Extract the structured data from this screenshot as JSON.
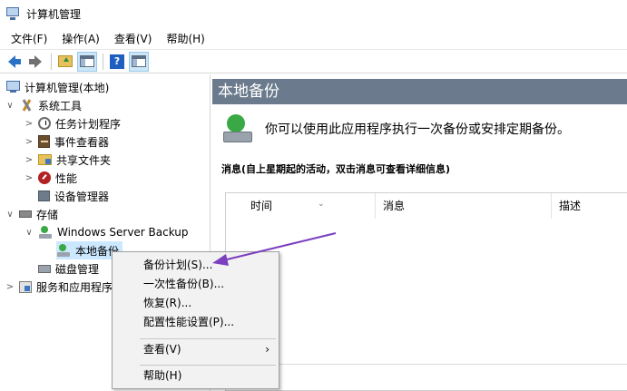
{
  "window": {
    "title": "计算机管理"
  },
  "menubar": {
    "items": [
      "文件(F)",
      "操作(A)",
      "查看(V)",
      "帮助(H)"
    ]
  },
  "toolbar": {
    "buttons": [
      "back-icon",
      "forward-icon",
      "up-folder-icon",
      "show-hide-tree-icon",
      "help-icon",
      "show-action-pane-icon"
    ],
    "help_glyph": "?"
  },
  "tree": {
    "items": [
      {
        "label": "计算机管理(本地)",
        "icon": "computer-icon",
        "expander": ""
      },
      {
        "label": "系统工具",
        "icon": "tools-icon",
        "expander": "∨"
      },
      {
        "label": "任务计划程序",
        "icon": "clock-icon",
        "expander": ">"
      },
      {
        "label": "事件查看器",
        "icon": "event-viewer-icon",
        "expander": ">"
      },
      {
        "label": "共享文件夹",
        "icon": "shared-folder-icon",
        "expander": ">"
      },
      {
        "label": "性能",
        "icon": "performance-icon",
        "expander": ">"
      },
      {
        "label": "设备管理器",
        "icon": "device-manager-icon",
        "expander": ""
      },
      {
        "label": "存储",
        "icon": "storage-icon",
        "expander": "∨"
      },
      {
        "label": "Windows Server Backup",
        "icon": "backup-icon",
        "expander": "∨"
      },
      {
        "label": "本地备份",
        "icon": "backup-icon",
        "expander": ""
      },
      {
        "label": "磁盘管理",
        "icon": "disk-icon",
        "expander": ""
      },
      {
        "label": "服务和应用程序",
        "icon": "services-icon",
        "expander": ">"
      }
    ]
  },
  "main": {
    "header": "本地备份",
    "intro": "你可以使用此应用程序执行一次备份或安排定期备份。",
    "messages_title": "消息(自上星期起的活动，双击消息可查看详细信息)",
    "columns": [
      "时间",
      "消息",
      "描述"
    ],
    "sort_caret": "⌄"
  },
  "context_menu": {
    "items": [
      "备份计划(S)...",
      "一次性备份(B)...",
      "恢复(R)...",
      "配置性能设置(P)...",
      "查看(V)",
      "帮助(H)"
    ],
    "submenu_arrow": "›"
  },
  "annotation": {
    "color": "#7b3fc0"
  }
}
